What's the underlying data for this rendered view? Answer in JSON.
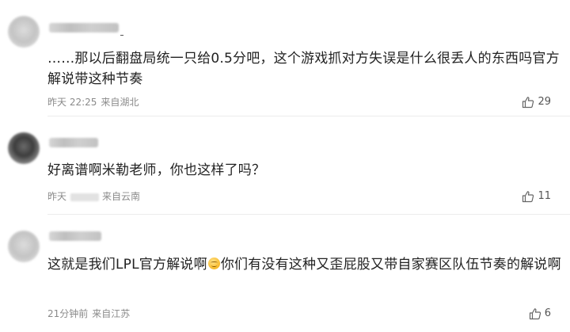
{
  "comments": [
    {
      "text": "……那以后翻盘局统一只给0.5分吧，这个游戏抓对方失误是什么很丢人的东西吗官方解说带这种节奏",
      "time": "昨天 22:25",
      "location": "来自湖北",
      "likes": "29"
    },
    {
      "text": "好离谱啊米勒老师，你也这样了吗？",
      "time": "昨天",
      "location": "来自云南",
      "likes": "11"
    },
    {
      "text_before_emoji": "这就是我们LPL官方解说啊",
      "emoji": "smile-emoji",
      "text_after_emoji": "你们有没有这种又歪屁股又带自家赛区队伍节奏的解说啊",
      "time": "21分钟前",
      "location": "来自江苏",
      "likes": "6"
    }
  ],
  "icons": {
    "like": "thumbs-up-icon"
  },
  "colors": {
    "text": "#222222",
    "meta": "#8a8a8a",
    "divider": "#ececec"
  }
}
